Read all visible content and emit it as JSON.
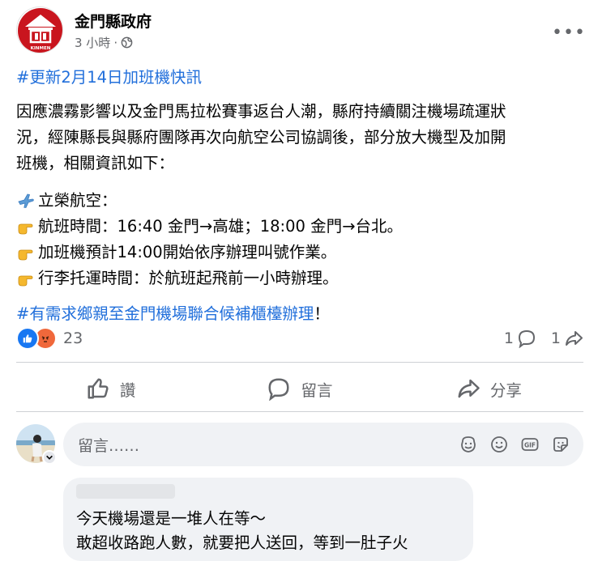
{
  "post_header": {
    "page_name": "金門縣政府",
    "time": "3 小時",
    "separator": "·",
    "more_label": "•••",
    "logo_text": "KINMEN"
  },
  "post": {
    "hashtag_update": "#更新2月14日加班機快訊",
    "body_lines": [
      "因應濃霧影響以及金門馬拉松賽事返台人潮，縣府持續關注機場疏運狀",
      "況，經陳縣長與縣府團隊再次向航空公司協調後，部分放大機型及加開",
      "班機，相關資訊如下："
    ],
    "airline": "立榮航空：",
    "bullets": [
      "航班時間：16:40 金門→高雄；18:00 金門→台北。",
      "加班機預計14:00開始依序辦理叫號作業。",
      "行李托運時間：於航班起飛前一小時辦理。"
    ],
    "hashtag_closing": "#有需求鄉親至金門機場聯合候補櫃檯辦理",
    "closing_suffix": "！"
  },
  "reactions": {
    "count": "23",
    "comments": "1",
    "shares": "1"
  },
  "actions": {
    "like": "讚",
    "comment": "留言",
    "share": "分享"
  },
  "comment_input": {
    "placeholder": "留言……"
  },
  "reply": {
    "lines": [
      "今天機場還是一堆人在等～",
      "敢超收路跑人數，就要把人送回，等到一肚子火"
    ]
  },
  "colors": {
    "brand_red": "#c9151e",
    "link_blue": "#216fdb",
    "like_blue": "#1877f2",
    "angry_orange": "#f0683b",
    "secondary_text": "#65676b"
  }
}
